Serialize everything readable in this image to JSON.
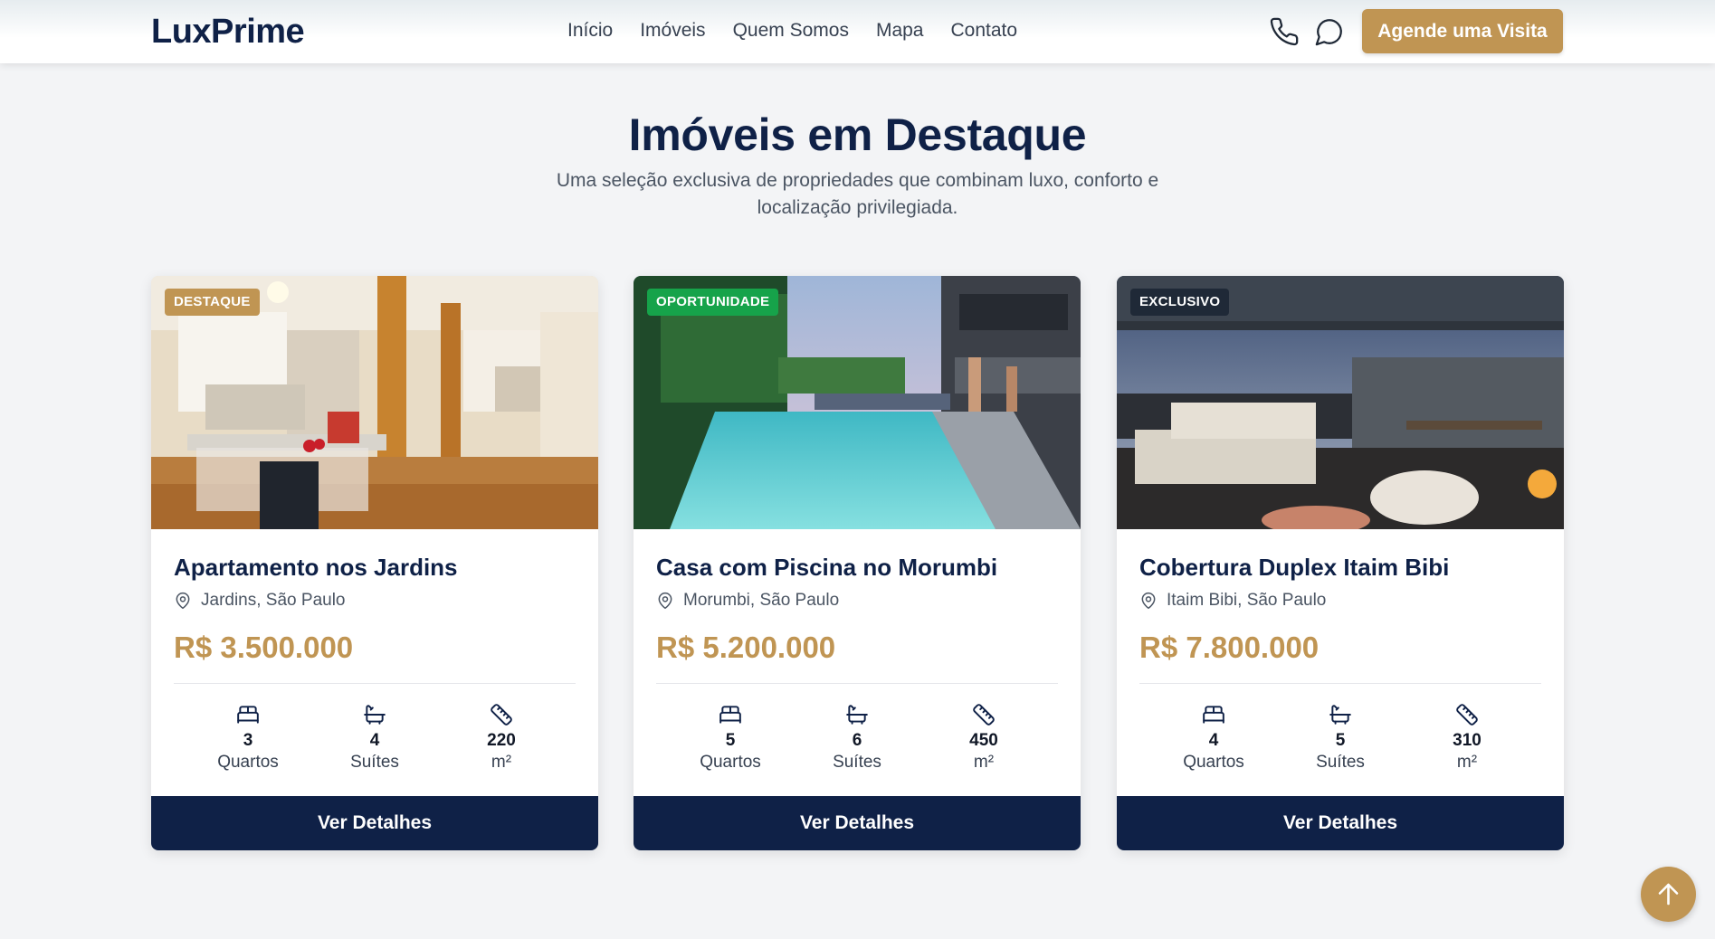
{
  "header": {
    "logo": "LuxPrime",
    "nav": [
      "Início",
      "Imóveis",
      "Quem Somos",
      "Mapa",
      "Contato"
    ],
    "phone_icon": "phone-icon",
    "chat_icon": "chat-bubble-icon",
    "cta_label": "Agende uma Visita"
  },
  "section": {
    "title": "Imóveis em Destaque",
    "subtitle": "Uma seleção exclusiva de propriedades que combinam luxo, conforto e localização privilegiada."
  },
  "colors": {
    "navy": "#0f2147",
    "gold": "#c09553",
    "green": "#16a34a",
    "dark_badge": "#1f2937"
  },
  "cards": [
    {
      "badge": "DESTAQUE",
      "badge_color": "#c09553",
      "image": "apartment-living-room",
      "title": "Apartamento nos Jardins",
      "location": "Jardins, São Paulo",
      "price": "R$ 3.500.000",
      "bedrooms": "3",
      "bedrooms_label": "Quartos",
      "suites": "4",
      "suites_label": "Suítes",
      "area": "220",
      "area_label": "m²",
      "button": "Ver Detalhes"
    },
    {
      "badge": "OPORTUNIDADE",
      "badge_color": "#16a34a",
      "image": "house-pool",
      "title": "Casa com Piscina no Morumbi",
      "location": "Morumbi, São Paulo",
      "price": "R$ 5.200.000",
      "bedrooms": "5",
      "bedrooms_label": "Quartos",
      "suites": "6",
      "suites_label": "Suítes",
      "area": "450",
      "area_label": "m²",
      "button": "Ver Detalhes"
    },
    {
      "badge": "EXCLUSIVO",
      "badge_color": "#1f2937",
      "image": "penthouse-terrace",
      "title": "Cobertura Duplex Itaim Bibi",
      "location": "Itaim Bibi, São Paulo",
      "price": "R$ 7.800.000",
      "bedrooms": "4",
      "bedrooms_label": "Quartos",
      "suites": "5",
      "suites_label": "Suítes",
      "area": "310",
      "area_label": "m²",
      "button": "Ver Detalhes"
    }
  ],
  "scroll_top_icon": "arrow-up-icon"
}
